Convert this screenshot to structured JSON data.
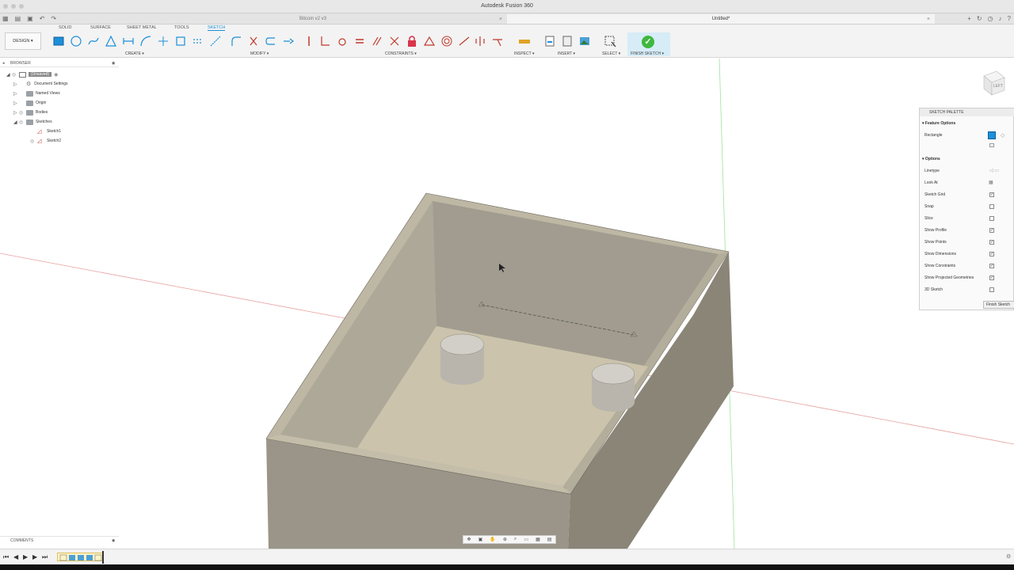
{
  "window": {
    "title": "Autodesk Fusion 360"
  },
  "tabs": {
    "doc1": "Bitcoin v2 v3",
    "doc2": "Untitled*"
  },
  "workspace_tabs": [
    "SOLID",
    "SURFACE",
    "SHEET METAL",
    "TOOLS",
    "SKETCH"
  ],
  "design_button": "DESIGN ▾",
  "toolbar_groups": {
    "create": "CREATE ▾",
    "modify": "MODIFY ▾",
    "constraints": "CONSTRAINTS ▾",
    "inspect": "INSPECT ▾",
    "insert": "INSERT ▾",
    "select": "SELECT ▾",
    "finish": "FINISH SKETCH ▾"
  },
  "browser": {
    "title": "BROWSER",
    "root": "(Unsaved)",
    "items": [
      "Document Settings",
      "Named Views",
      "Origin",
      "Bodies",
      "Sketches",
      "Sketch1",
      "Sketch2"
    ]
  },
  "comments_label": "COMMENTS",
  "sketch_palette": {
    "title": "SKETCH PALETTE",
    "feature_options": "Feature Options",
    "rectangle_label": "Rectangle",
    "options": "Options",
    "rows": [
      {
        "label": "Linetype",
        "checked": null
      },
      {
        "label": "Look At",
        "checked": null
      },
      {
        "label": "Sketch Grid",
        "checked": true
      },
      {
        "label": "Snap",
        "checked": false
      },
      {
        "label": "Slice",
        "checked": false
      },
      {
        "label": "Show Profile",
        "checked": true
      },
      {
        "label": "Show Points",
        "checked": true
      },
      {
        "label": "Show Dimensions",
        "checked": true
      },
      {
        "label": "Show Constraints",
        "checked": true
      },
      {
        "label": "Show Projected Geometries",
        "checked": true
      },
      {
        "label": "3D Sketch",
        "checked": false
      }
    ],
    "finish_button": "Finish Sketch"
  },
  "viewcube_label": "LEFT",
  "colors": {
    "accent": "#1d8fd8",
    "finish_bg": "#d6ecf7",
    "model_face": "#aaa59a",
    "floor": "#cfc7b0"
  }
}
